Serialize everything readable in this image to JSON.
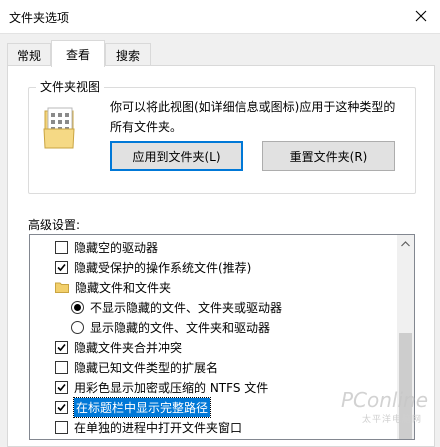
{
  "window": {
    "title": "文件夹选项"
  },
  "tabs": [
    {
      "label": "常规",
      "active": false
    },
    {
      "label": "查看",
      "active": true
    },
    {
      "label": "搜索",
      "active": false
    }
  ],
  "folder_views": {
    "group_title": "文件夹视图",
    "description": "你可以将此视图(如详细信息或图标)应用于这种类型的所有文件夹。",
    "apply_button": "应用到文件夹(L)",
    "reset_button": "重置文件夹(R)"
  },
  "advanced": {
    "label": "高级设置:",
    "items": [
      {
        "type": "checkbox",
        "checked": false,
        "label": "隐藏空的驱动器",
        "indent": 1
      },
      {
        "type": "checkbox",
        "checked": true,
        "label": "隐藏受保护的操作系统文件(推荐)",
        "indent": 1
      },
      {
        "type": "folder",
        "label": "隐藏文件和文件夹",
        "indent": 1
      },
      {
        "type": "radio",
        "checked": true,
        "label": "不显示隐藏的文件、文件夹或驱动器",
        "indent": 2
      },
      {
        "type": "radio",
        "checked": false,
        "label": "显示隐藏的文件、文件夹和驱动器",
        "indent": 2
      },
      {
        "type": "checkbox",
        "checked": true,
        "label": "隐藏文件夹合并冲突",
        "indent": 1
      },
      {
        "type": "checkbox",
        "checked": false,
        "label": "隐藏已知文件类型的扩展名",
        "indent": 1
      },
      {
        "type": "checkbox",
        "checked": true,
        "label": "用彩色显示加密或压缩的 NTFS 文件",
        "indent": 1
      },
      {
        "type": "checkbox",
        "checked": true,
        "label": "在标题栏中显示完整路径",
        "indent": 1,
        "selected": true
      },
      {
        "type": "checkbox",
        "checked": false,
        "label": "在单独的进程中打开文件夹窗口",
        "indent": 1
      }
    ]
  },
  "watermark": {
    "brand": "PConline",
    "sub": "太平洋电脑网"
  },
  "colors": {
    "selection": "#0078d7",
    "window_bg": "#f0f0f0"
  }
}
